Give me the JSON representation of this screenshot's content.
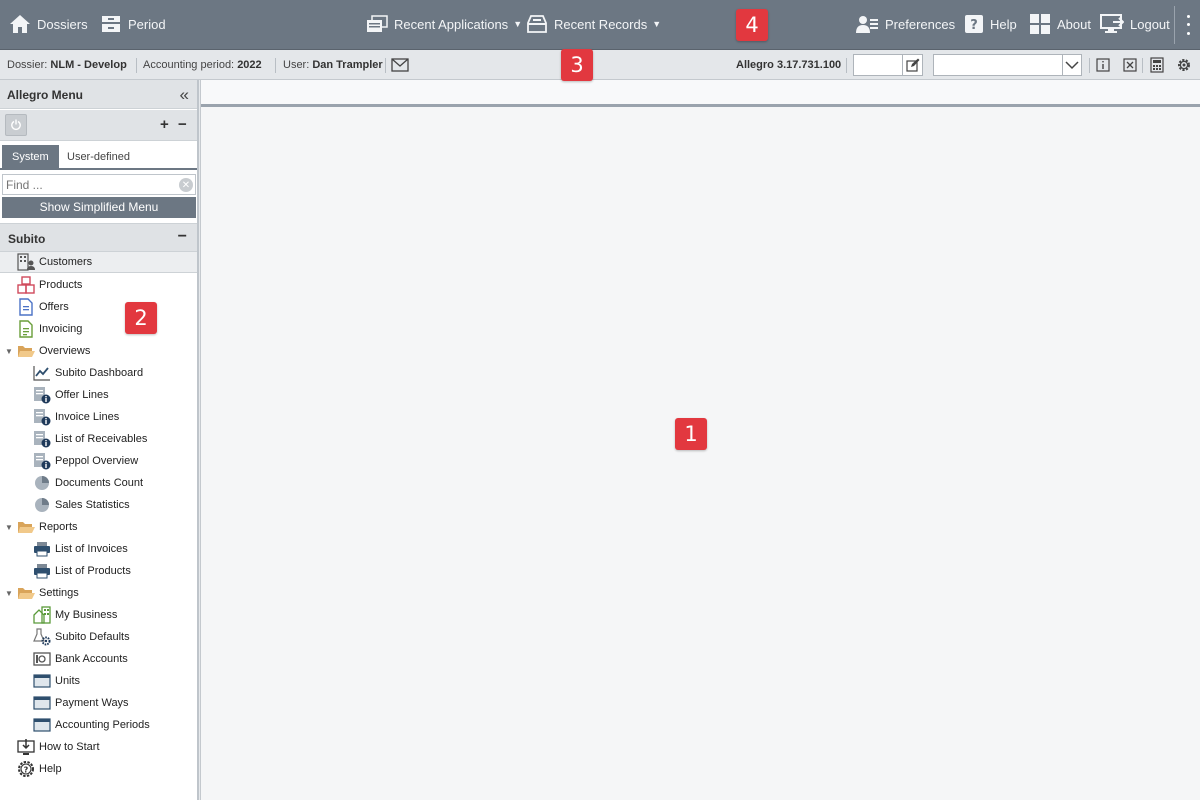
{
  "toolbar": {
    "dossiers": "Dossiers",
    "period": "Period",
    "recent_applications": "Recent Applications",
    "recent_records": "Recent Records",
    "preferences": "Preferences",
    "help": "Help",
    "about": "About",
    "logout": "Logout"
  },
  "infobar": {
    "dossier_label": "Dossier:",
    "dossier_value": "NLM - Develop",
    "period_label": "Accounting period:",
    "period_value": "2022",
    "user_label": "User:",
    "user_value": "Dan Trampler",
    "version": "Allegro 3.17.731.100",
    "record_input_value": "",
    "record_select_value": ""
  },
  "badges": {
    "b1": "1",
    "b2": "2",
    "b3": "3",
    "b4": "4"
  },
  "sidebar": {
    "title": "Allegro Menu",
    "tabs": {
      "system": "System",
      "user_defined": "User-defined"
    },
    "find_placeholder": "Find ...",
    "show_simplified": "Show Simplified Menu",
    "group": "Subito",
    "items": {
      "customers": "Customers",
      "products": "Products",
      "offers": "Offers",
      "invoicing": "Invoicing",
      "overviews": "Overviews",
      "subito_dashboard": "Subito Dashboard",
      "offer_lines": "Offer Lines",
      "invoice_lines": "Invoice Lines",
      "list_of_receivables": "List of Receivables",
      "peppol_overview": "Peppol Overview",
      "documents_count": "Documents Count",
      "sales_statistics": "Sales Statistics",
      "reports": "Reports",
      "list_of_invoices": "List of Invoices",
      "list_of_products": "List of Products",
      "settings": "Settings",
      "my_business": "My Business",
      "subito_defaults": "Subito Defaults",
      "bank_accounts": "Bank Accounts",
      "units": "Units",
      "payment_ways": "Payment Ways",
      "accounting_periods": "Accounting Periods",
      "how_to_start": "How to Start",
      "help": "Help"
    }
  },
  "colors": {
    "toolbar": "#6c7783",
    "badge": "#e2383f",
    "active_tab": "#6c7783"
  }
}
